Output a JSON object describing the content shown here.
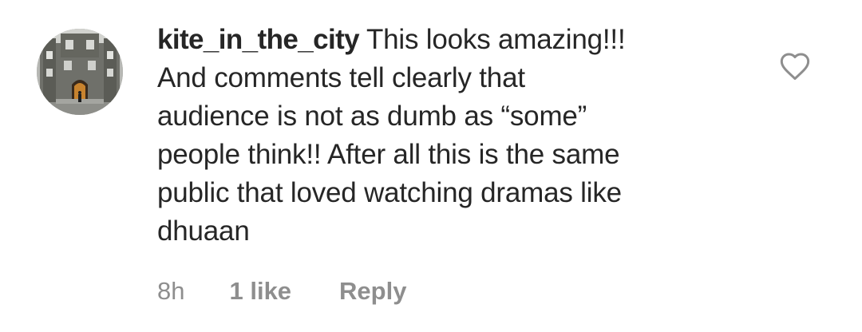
{
  "comment": {
    "username": "kite_in_the_city",
    "text_line1": "This looks amazing!!!",
    "text_rest": "And comments tell clearly that\naudience is not as dumb as “some”\npeople think!! After all this is the same\npublic that loved watching dramas like\ndhuaan",
    "time": "8h",
    "likes": "1 like",
    "reply": "Reply"
  },
  "icons": {
    "avatar": "avatar-building-photo",
    "like": "heart-outline-icon"
  },
  "colors": {
    "text": "#262626",
    "meta": "#8e8e8e",
    "background": "#ffffff"
  }
}
